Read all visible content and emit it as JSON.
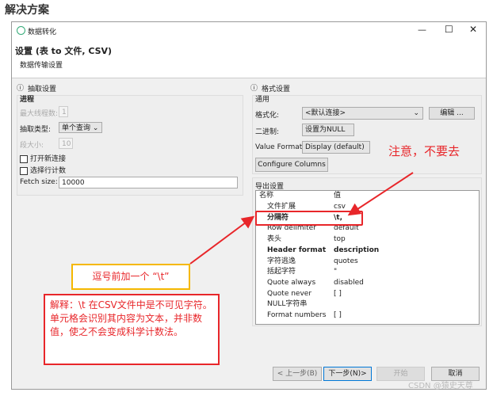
{
  "page_title": "解决方案",
  "window": {
    "title": "数据转化",
    "heading": "设置 (表 to 文件, CSV)",
    "subheading": "数据传输设置"
  },
  "left": {
    "section": "抽取设置",
    "group": "进程",
    "max_threads_label": "最大线程数:",
    "max_threads": "1",
    "extract_type_label": "抽取类型:",
    "extract_type": "单个查询",
    "segment_label": "段大小:",
    "segment": "10",
    "open_conn": "打开新连接",
    "select_count": "选择行计数",
    "fetch_label": "Fetch size:",
    "fetch": "10000"
  },
  "right": {
    "section": "格式设置",
    "group": "通用",
    "format_label": "格式化:",
    "format": "<默认连接>",
    "edit": "编辑 ...",
    "binary_label": "二进制:",
    "binary": "设置为NULL",
    "vf_label": "Value Format:",
    "vf": "Display (default)",
    "configure": "Configure Columns ...",
    "export": "导出设置",
    "table": {
      "h_name": "名称",
      "h_value": "值",
      "rows": [
        {
          "n": "文件扩展",
          "v": "csv"
        },
        {
          "n": "分隔符",
          "v": "\\t,"
        },
        {
          "n": "Row delimiter",
          "v": "default"
        },
        {
          "n": "表头",
          "v": "top"
        },
        {
          "n": "Header format",
          "v": "description"
        },
        {
          "n": "字符逃逸",
          "v": "quotes"
        },
        {
          "n": "括起字符",
          "v": "\""
        },
        {
          "n": "Quote always",
          "v": "disabled"
        },
        {
          "n": "Quote never",
          "v": "[ ]"
        },
        {
          "n": "NULL字符串",
          "v": ""
        },
        {
          "n": "Format numbers",
          "v": "[ ]"
        }
      ]
    }
  },
  "buttons": {
    "back": "< 上一步(B)",
    "next": "下一步(N)>",
    "start": "开始",
    "cancel": "取消"
  },
  "watermark": "CSDN @猿史天尊",
  "annotations": {
    "note": "注意，不要去",
    "tip": "逗号前加一个 “\\t”",
    "explain": "解释：\\t 在CSV文件中是不可见字符。单元格会识别其内容为文本，并非数值，使之不会变成科学计数法。"
  }
}
